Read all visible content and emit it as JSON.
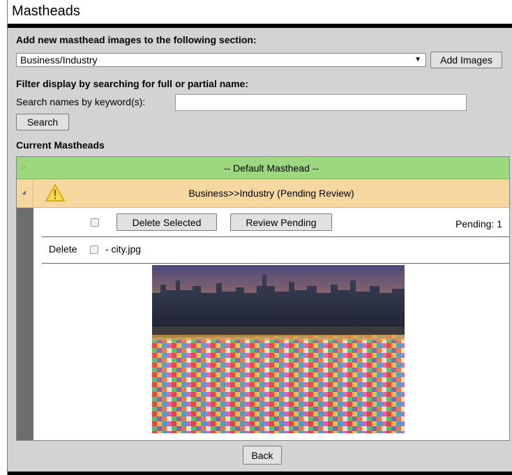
{
  "page": {
    "title": "Mastheads",
    "add_section_label": "Add new masthead images to the following section:",
    "section_select_value": "Business/Industry",
    "add_images_button": "Add Images",
    "filter_label": "Filter display by searching for full or partial name:",
    "search_label": "Search names by keyword(s):",
    "search_value": "",
    "search_button": "Search",
    "current_label": "Current Mastheads",
    "back_button": "Back"
  },
  "grid": {
    "default_row": "-- Default Masthead --",
    "pending_row": "Business>>Industry (Pending Review)",
    "delete_selected_button": "Delete Selected",
    "review_pending_button": "Review Pending",
    "pending_count": "Pending: 1",
    "item_delete_label": "Delete",
    "item_filename": "- city.jpg"
  },
  "icons": {
    "dropdown": "chevron-down-icon",
    "collapsed": "expand-arrow-icon",
    "expanded": "collapse-arrow-icon",
    "warning": "warning-triangle-icon"
  },
  "colors": {
    "default_row": "#9ed87e",
    "pending_row": "#f5d89f",
    "panel": "#d3d3d3"
  }
}
